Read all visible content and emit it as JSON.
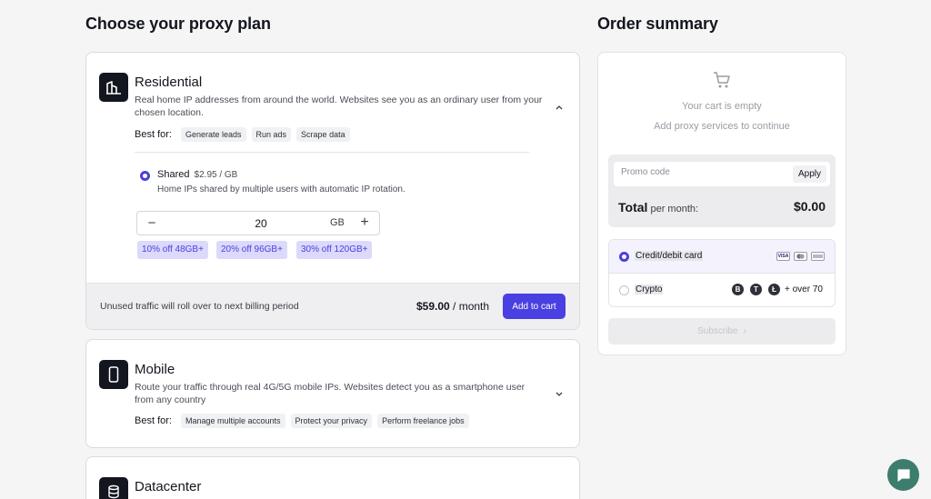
{
  "left_title": "Choose your proxy plan",
  "right_title": "Order summary",
  "residential": {
    "title": "Residential",
    "desc": "Real home IP addresses from around the world. Websites see you as an ordinary user from your chosen location.",
    "best_for_label": "Best for:",
    "tags": [
      "Generate leads",
      "Run ads",
      "Scrape data"
    ],
    "option": {
      "name": "Shared",
      "price": "$2.95 / GB",
      "desc": "Home IPs shared by multiple users with automatic IP rotation."
    },
    "stepper": {
      "minus": "−",
      "value": "20",
      "unit": "GB",
      "plus": "+"
    },
    "discounts": [
      "10% off 48GB+",
      "20% off 96GB+",
      "30% off 120GB+"
    ],
    "footer_note": "Unused traffic will roll over to next billing period",
    "price_amount": "$59.00",
    "price_period": " / month",
    "add_to_cart": "Add to cart"
  },
  "mobile": {
    "title": "Mobile",
    "desc": "Route your traffic through real 4G/5G mobile IPs. Websites detect you as a smartphone user from any country",
    "best_for_label": "Best for:",
    "tags": [
      "Manage multiple accounts",
      "Protect your privacy",
      "Perform freelance jobs"
    ]
  },
  "datacenter": {
    "title": "Datacenter"
  },
  "summary": {
    "empty_title": "Your cart is empty",
    "empty_sub": "Add proxy services to continue",
    "promo_placeholder": "Promo code",
    "apply": "Apply",
    "total_label": "Total",
    "total_suffix": " per month:",
    "total_amount": "$0.00",
    "payment": {
      "card_label": "Credit/debit card",
      "crypto_label": "Crypto",
      "crypto_more": "+ over 70",
      "card_brands": [
        "VISA",
        "MC",
        "AMEX"
      ],
      "coins": [
        "B",
        "T",
        "Ł"
      ]
    },
    "subscribe": "Subscribe",
    "subscribe_arrow": "›"
  },
  "colors": {
    "accent": "#4a3fe0",
    "accent_soft": "#dcdafb",
    "dark": "#14161f",
    "chat": "#3c7d6e"
  },
  "icons": {
    "residential": "house-icon",
    "mobile": "phone-icon",
    "datacenter": "database-icon",
    "cart": "cart-icon",
    "chat": "chat-icon"
  }
}
